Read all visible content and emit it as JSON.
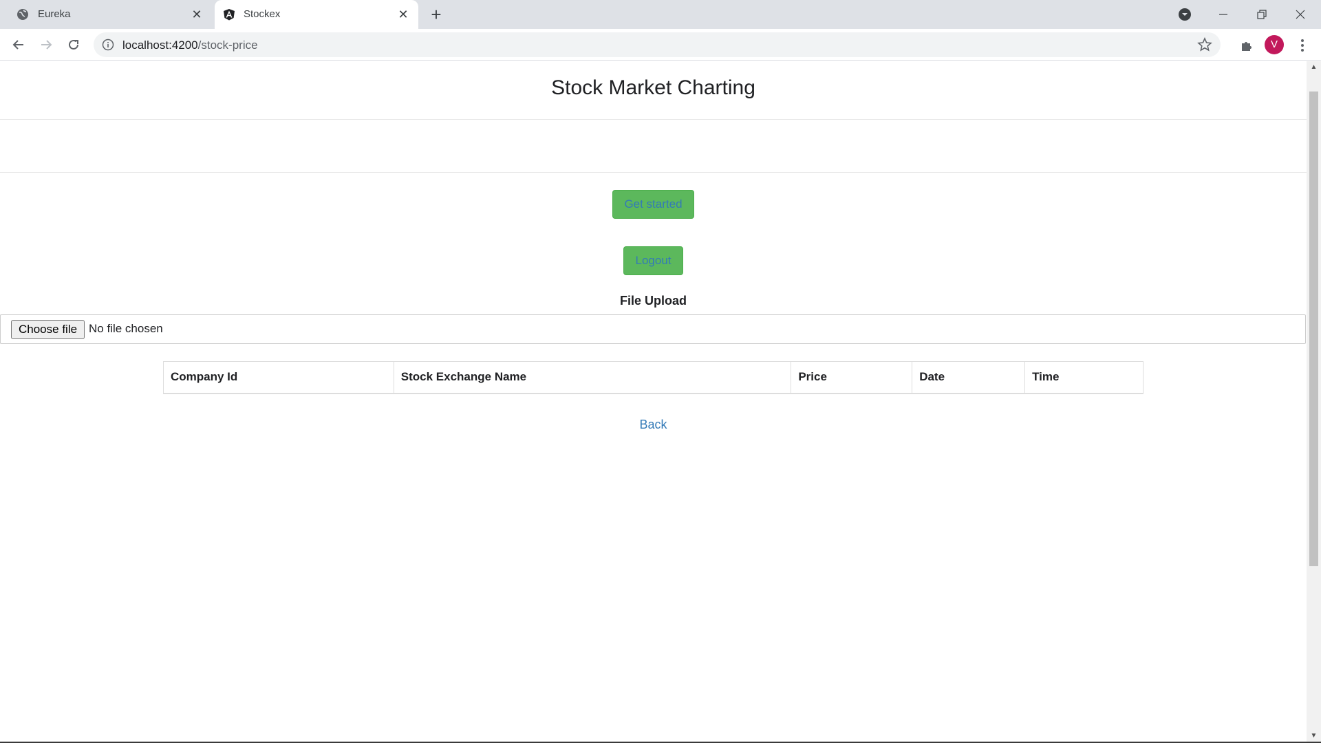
{
  "browser": {
    "tabs": [
      {
        "title": "Eureka",
        "active": false,
        "icon": "globe-icon"
      },
      {
        "title": "Stockex",
        "active": true,
        "icon": "angular-icon"
      }
    ],
    "url_host": "localhost:4200",
    "url_path": "/stock-price",
    "avatar_letter": "V",
    "avatar_color": "#c2185b"
  },
  "page": {
    "title": "Stock Market Charting",
    "buttons": {
      "get_started": "Get started",
      "logout": "Logout"
    },
    "upload": {
      "label": "File Upload",
      "choose_button": "Choose file",
      "status": "No file chosen"
    },
    "table": {
      "headers": [
        "Company Id",
        "Stock Exchange Name",
        "Price",
        "Date",
        "Time"
      ],
      "rows": []
    },
    "back_link": "Back"
  },
  "colors": {
    "button_green": "#5cb85c",
    "link_blue": "#337ab7"
  }
}
